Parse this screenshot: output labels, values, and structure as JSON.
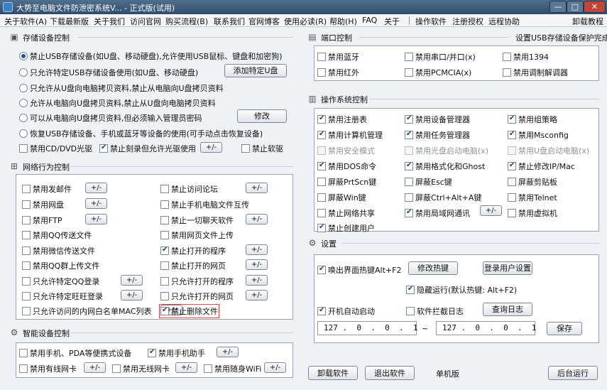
{
  "window": {
    "title": "大势至电脑文件防泄密系统V... - 正式版(试用)",
    "min": "—",
    "max": "□",
    "close": "✕"
  },
  "menu": [
    "关于软件(A)",
    "下载最新版",
    "关于我们",
    "访问官网",
    "购买流程(B)",
    "联系我们",
    "官网博客",
    "使用必读(R)",
    "帮助(H)",
    "FAQ",
    "关于",
    "操作软件",
    "注册授权",
    "远程协助",
    "卸载教程"
  ],
  "storage": {
    "title": "存储设备控制",
    "options": [
      "禁止USB存储设备(如U盘、移动硬盘),允许使用USB鼠标、键盘和加密狗)",
      "只允许特定USB存储设备使用(如U盘、移动硬盘)",
      "只允许从U盘向电脑拷贝资料,禁止从电脑向U盘拷贝资料",
      "允许从电脑向U盘拷贝资料,禁止从U盘向电脑拷贝资料",
      "可以从电脑向U盘拷贝资料,但必须输入管理员密码",
      "恢复USB存储设备、手机或蓝牙等设备的使用(可手动点击恢复设备)"
    ],
    "selected": 0,
    "add_udisk": "添加特定U盘",
    "modify": "修改",
    "cd_disable": "禁用CD/DVD光驱",
    "cd_burn": "禁止刻录但允许光驱使用",
    "floppy": "禁止软驱",
    "toggle": "+/-"
  },
  "network": {
    "title": "网络行为控制",
    "left": [
      {
        "label": "禁用发邮件",
        "checked": false,
        "btn": true
      },
      {
        "label": "禁用网盘",
        "checked": false,
        "btn": true
      },
      {
        "label": "禁用FTP",
        "checked": false,
        "btn": true
      },
      {
        "label": "禁用QQ传送文件",
        "checked": false,
        "btn": false
      },
      {
        "label": "禁用微信传送文件",
        "checked": false,
        "btn": false
      },
      {
        "label": "禁用QQ群上传文件",
        "checked": false,
        "btn": false
      },
      {
        "label": "只允许特定QQ登录",
        "checked": false,
        "btn": true
      },
      {
        "label": "只允许特定旺旺登录",
        "checked": false,
        "btn": true
      },
      {
        "label": "只允许访问的内网白名单MAC列表",
        "checked": false,
        "btn": true
      }
    ],
    "right": [
      {
        "label": "禁止访问论坛",
        "checked": false,
        "btn": true
      },
      {
        "label": "禁止手机电脑文件互传",
        "checked": false,
        "btn": false
      },
      {
        "label": "禁止一切聊天软件",
        "checked": false,
        "btn": true
      },
      {
        "label": "禁用网页文件上传",
        "checked": false,
        "btn": false
      },
      {
        "label": "禁止打开的程序",
        "checked": true,
        "btn": true
      },
      {
        "label": "禁止打开的网页",
        "checked": false,
        "btn": true
      },
      {
        "label": "只允许打开的程序",
        "checked": false,
        "btn": true
      },
      {
        "label": "只允许打开的网页",
        "checked": false,
        "btn": true
      },
      {
        "label": "禁止删除文件",
        "checked": true,
        "btn": false
      }
    ]
  },
  "smart": {
    "title": "智能设备控制",
    "pda": "禁用手机、PDA等便携式设备",
    "assistant": "禁用手机助手",
    "wired": "禁用有线网卡",
    "wireless": "禁用无线网卡",
    "wifi": "禁用随身WiFi"
  },
  "port": {
    "title": "端口控制",
    "status": "设置USB存储设备保护完成",
    "items": [
      {
        "label": "禁用蓝牙",
        "checked": false
      },
      {
        "label": "禁用串口/并口(x)",
        "checked": false
      },
      {
        "label": "禁用1394",
        "checked": false
      },
      {
        "label": "禁用红外",
        "checked": false
      },
      {
        "label": "禁用PCMCIA(x)",
        "checked": false
      },
      {
        "label": "禁用调制解调器",
        "checked": false
      }
    ]
  },
  "os": {
    "title": "操作系统控制",
    "items": [
      {
        "label": "禁用注册表",
        "checked": true,
        "disabled": false
      },
      {
        "label": "禁用设备管理器",
        "checked": true,
        "disabled": false
      },
      {
        "label": "禁用组策略",
        "checked": true,
        "disabled": false
      },
      {
        "label": "禁用计算机管理",
        "checked": true,
        "disabled": false
      },
      {
        "label": "禁用任务管理器",
        "checked": true,
        "disabled": false
      },
      {
        "label": "禁用Msconfig",
        "checked": true,
        "disabled": false
      },
      {
        "label": "禁用安全模式",
        "checked": false,
        "disabled": true
      },
      {
        "label": "禁用光盘启动电脑(x)",
        "checked": false,
        "disabled": true
      },
      {
        "label": "禁用U盘启动电脑(x)",
        "checked": false,
        "disabled": true
      },
      {
        "label": "禁用DOS命令",
        "checked": true,
        "disabled": false
      },
      {
        "label": "禁用格式化和Ghost",
        "checked": true,
        "disabled": false
      },
      {
        "label": "禁止修改IP/Mac",
        "checked": true,
        "disabled": false
      },
      {
        "label": "屏蔽PrtScn键",
        "checked": false,
        "disabled": false
      },
      {
        "label": "屏蔽Esc键",
        "checked": false,
        "disabled": false
      },
      {
        "label": "屏蔽剪贴板",
        "checked": false,
        "disabled": false
      },
      {
        "label": "屏蔽Win键",
        "checked": false,
        "disabled": false
      },
      {
        "label": "屏蔽Ctrl+Alt+A键",
        "checked": false,
        "disabled": false
      },
      {
        "label": "禁用Telnet",
        "checked": false,
        "disabled": false
      },
      {
        "label": "禁止网络共享",
        "checked": false,
        "disabled": false
      },
      {
        "label": "禁用局域网通讯",
        "checked": true,
        "disabled": false
      },
      {
        "label": "禁用虚拟机",
        "checked": false,
        "disabled": false
      },
      {
        "label": "禁止创建用户",
        "checked": true,
        "disabled": false
      }
    ],
    "toggle": "+/-"
  },
  "settings": {
    "title": "设置",
    "hotkey": "唤出界面热键Alt+F2",
    "modify_hotkey": "修改热键",
    "login_setting": "登录用户设置",
    "hide_hotkey": "隐藏运行(默认热键: Alt+F2)",
    "autostart": "开机自动启动",
    "intercept_log": "软件拦截日志",
    "query_log": "查询日志",
    "ip_from": "127 .  0  .  0  .  1",
    "ip_sep": "~",
    "ip_to": "127 .  0  .  0  .  1",
    "save": "保存"
  },
  "footer": {
    "uninstall": "卸载软件",
    "exit": "退出软件",
    "mode": "单机版",
    "background": "后台运行"
  }
}
